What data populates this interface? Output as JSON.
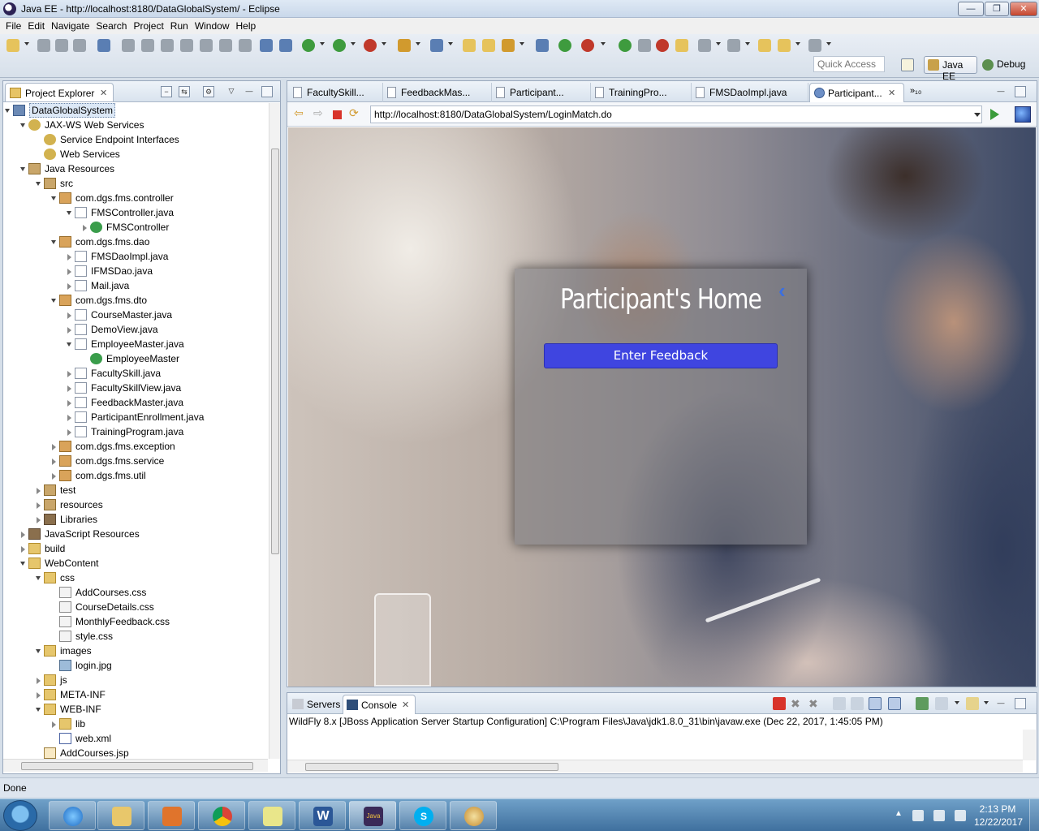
{
  "window": {
    "title": "Java EE - http://localhost:8180/DataGlobalSystem/ - Eclipse",
    "min_glyph": "—",
    "max_glyph": "❐",
    "close_glyph": "✕"
  },
  "menu": [
    "File",
    "Edit",
    "Navigate",
    "Search",
    "Project",
    "Run",
    "Window",
    "Help"
  ],
  "toolbar": {
    "quick_access_placeholder": "Quick Access",
    "perspectives": [
      "Java EE",
      "Debug"
    ]
  },
  "explorer": {
    "tab_label": "Project Explorer",
    "tree": [
      {
        "label": "DataGlobalSystem",
        "icon": "project-icon",
        "depth": 0,
        "state": "expanded",
        "selected": true
      },
      {
        "label": "JAX-WS Web Services",
        "icon": "webservice-icon",
        "depth": 1,
        "state": "expanded"
      },
      {
        "label": "Service Endpoint Interfaces",
        "icon": "sei-icon",
        "depth": 2,
        "state": "none"
      },
      {
        "label": "Web Services",
        "icon": "webservice-icon",
        "depth": 2,
        "state": "none"
      },
      {
        "label": "Java Resources",
        "icon": "java-resources-icon",
        "depth": 1,
        "state": "expanded"
      },
      {
        "label": "src",
        "icon": "source-folder-icon",
        "depth": 2,
        "state": "expanded"
      },
      {
        "label": "com.dgs.fms.controller",
        "icon": "package-icon",
        "depth": 3,
        "state": "expanded"
      },
      {
        "label": "FMSController.java",
        "icon": "java-file-icon",
        "depth": 4,
        "state": "expanded"
      },
      {
        "label": "FMSController",
        "icon": "class-icon",
        "depth": 5,
        "state": "collapsed"
      },
      {
        "label": "com.dgs.fms.dao",
        "icon": "package-icon",
        "depth": 3,
        "state": "expanded"
      },
      {
        "label": "FMSDaoImpl.java",
        "icon": "java-file-icon",
        "depth": 4,
        "state": "collapsed"
      },
      {
        "label": "IFMSDao.java",
        "icon": "java-file-icon",
        "depth": 4,
        "state": "collapsed"
      },
      {
        "label": "Mail.java",
        "icon": "java-file-icon",
        "depth": 4,
        "state": "collapsed"
      },
      {
        "label": "com.dgs.fms.dto",
        "icon": "package-icon",
        "depth": 3,
        "state": "expanded"
      },
      {
        "label": "CourseMaster.java",
        "icon": "java-file-icon",
        "depth": 4,
        "state": "collapsed"
      },
      {
        "label": "DemoView.java",
        "icon": "java-file-icon",
        "depth": 4,
        "state": "collapsed"
      },
      {
        "label": "EmployeeMaster.java",
        "icon": "java-file-icon",
        "depth": 4,
        "state": "expanded"
      },
      {
        "label": "EmployeeMaster",
        "icon": "class-icon",
        "depth": 5,
        "state": "none"
      },
      {
        "label": "FacultySkill.java",
        "icon": "java-file-icon",
        "depth": 4,
        "state": "collapsed"
      },
      {
        "label": "FacultySkillView.java",
        "icon": "java-file-icon",
        "depth": 4,
        "state": "collapsed"
      },
      {
        "label": "FeedbackMaster.java",
        "icon": "java-file-icon",
        "depth": 4,
        "state": "collapsed"
      },
      {
        "label": "ParticipantEnrollment.java",
        "icon": "java-file-icon",
        "depth": 4,
        "state": "collapsed"
      },
      {
        "label": "TrainingProgram.java",
        "icon": "java-file-icon",
        "depth": 4,
        "state": "collapsed"
      },
      {
        "label": "com.dgs.fms.exception",
        "icon": "package-icon",
        "depth": 3,
        "state": "collapsed"
      },
      {
        "label": "com.dgs.fms.service",
        "icon": "package-icon",
        "depth": 3,
        "state": "collapsed"
      },
      {
        "label": "com.dgs.fms.util",
        "icon": "package-icon",
        "depth": 3,
        "state": "collapsed"
      },
      {
        "label": "test",
        "icon": "source-folder-icon",
        "depth": 2,
        "state": "collapsed"
      },
      {
        "label": "resources",
        "icon": "source-folder-icon",
        "depth": 2,
        "state": "collapsed"
      },
      {
        "label": "Libraries",
        "icon": "library-icon",
        "depth": 2,
        "state": "collapsed"
      },
      {
        "label": "JavaScript Resources",
        "icon": "library-icon",
        "depth": 1,
        "state": "collapsed"
      },
      {
        "label": "build",
        "icon": "folder-icon",
        "depth": 1,
        "state": "collapsed"
      },
      {
        "label": "WebContent",
        "icon": "folder-icon",
        "depth": 1,
        "state": "expanded"
      },
      {
        "label": "css",
        "icon": "folder-icon",
        "depth": 2,
        "state": "expanded"
      },
      {
        "label": "AddCourses.css",
        "icon": "css-file-icon",
        "depth": 3,
        "state": "none"
      },
      {
        "label": "CourseDetails.css",
        "icon": "css-file-icon",
        "depth": 3,
        "state": "none"
      },
      {
        "label": "MonthlyFeedback.css",
        "icon": "css-file-icon",
        "depth": 3,
        "state": "none"
      },
      {
        "label": "style.css",
        "icon": "css-file-icon",
        "depth": 3,
        "state": "none"
      },
      {
        "label": "images",
        "icon": "folder-icon",
        "depth": 2,
        "state": "expanded"
      },
      {
        "label": "login.jpg",
        "icon": "image-file-icon",
        "depth": 3,
        "state": "none"
      },
      {
        "label": "js",
        "icon": "folder-icon",
        "depth": 2,
        "state": "collapsed"
      },
      {
        "label": "META-INF",
        "icon": "folder-icon",
        "depth": 2,
        "state": "collapsed"
      },
      {
        "label": "WEB-INF",
        "icon": "folder-icon",
        "depth": 2,
        "state": "expanded"
      },
      {
        "label": "lib",
        "icon": "folder-icon",
        "depth": 3,
        "state": "collapsed"
      },
      {
        "label": "web.xml",
        "icon": "xml-file-icon",
        "depth": 3,
        "state": "none"
      },
      {
        "label": "AddCourses.jsp",
        "icon": "jsp-file-icon",
        "depth": 2,
        "state": "none"
      }
    ]
  },
  "editor": {
    "tabs": [
      {
        "label": "FacultySkill...",
        "icon": "java-file-icon",
        "active": false
      },
      {
        "label": "FeedbackMas...",
        "icon": "java-file-icon",
        "active": false
      },
      {
        "label": "Participant...",
        "icon": "java-file-icon",
        "active": false
      },
      {
        "label": "TrainingPro...",
        "icon": "java-file-icon",
        "active": false
      },
      {
        "label": "FMSDaoImpl.java",
        "icon": "java-file-icon",
        "active": false
      },
      {
        "label": "Participant...",
        "icon": "browser-tab-icon",
        "active": true
      }
    ],
    "more_tabs_label": "»₁₀",
    "url": "http://localhost:8180/DataGlobalSystem/LoginMatch.do"
  },
  "webpage": {
    "heading": "Participant's Home",
    "back_glyph": "‹",
    "button_label": "Enter Feedback"
  },
  "console": {
    "tabs": [
      {
        "label": "Servers",
        "active": false
      },
      {
        "label": "Console",
        "active": true
      }
    ],
    "line": "WildFly 8.x [JBoss Application Server Startup Configuration] C:\\Program Files\\Java\\jdk1.8.0_31\\bin\\javaw.exe (Dec 22, 2017, 1:45:05 PM)"
  },
  "status": {
    "text": "Done"
  },
  "taskbar": {
    "apps": [
      "internet-explorer-icon",
      "file-explorer-icon",
      "media-player-icon",
      "chrome-icon",
      "sticky-notes-icon",
      "word-icon",
      "eclipse-javaee-icon",
      "skype-icon",
      "paint-icon"
    ],
    "eclipse_label": "Java EE",
    "time": "2:13 PM",
    "date": "12/22/2017"
  },
  "colors": {
    "button_blue": "#3f45e0",
    "selection": "#dce8f6"
  }
}
